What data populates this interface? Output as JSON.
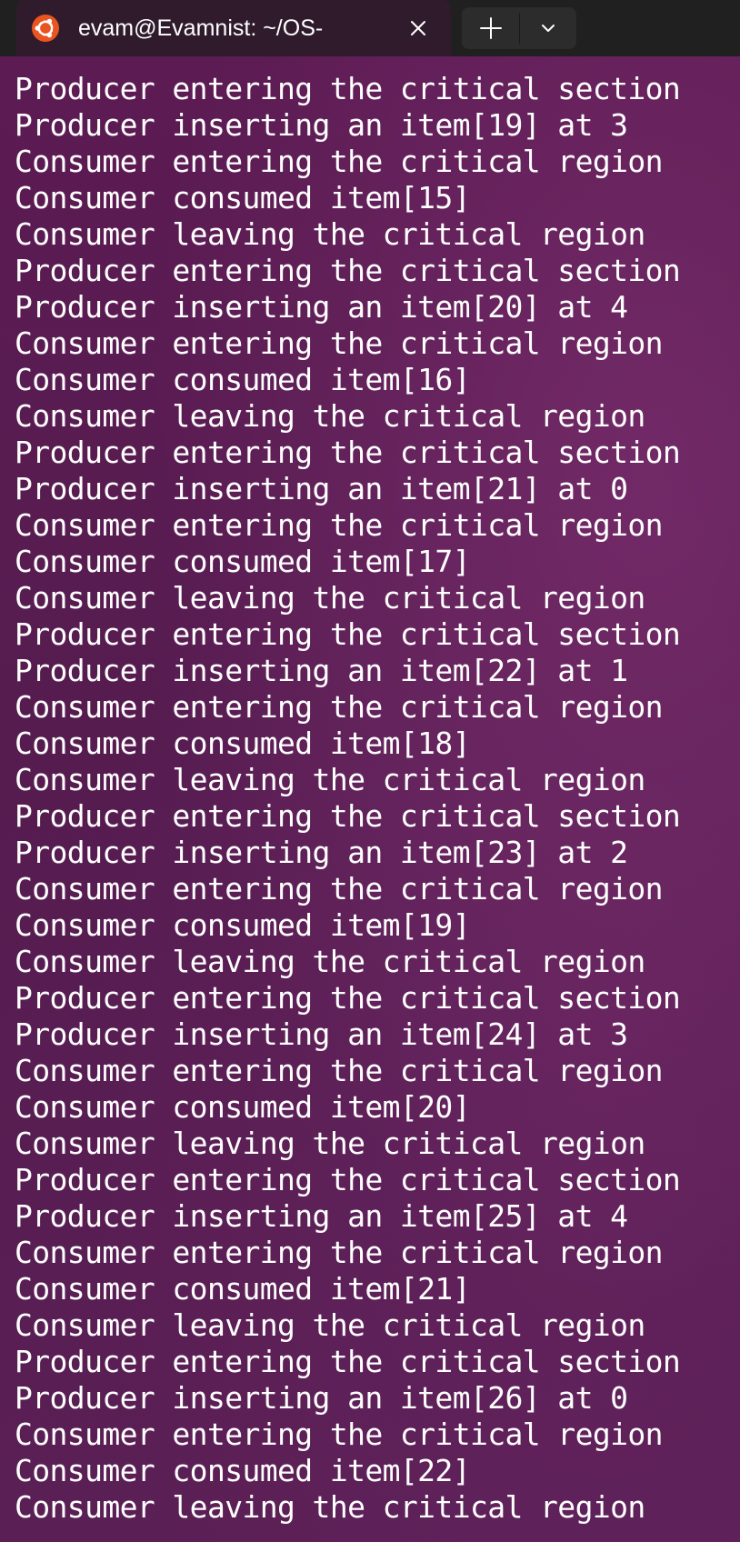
{
  "tab": {
    "title": "evam@Evamnist: ~/OS-",
    "icon": "ubuntu-logo-icon",
    "close_icon": "close-icon"
  },
  "toolbar": {
    "new_tab_icon": "plus-icon",
    "dropdown_icon": "chevron-down-icon"
  },
  "colors": {
    "terminal_bg": "#5c1b53",
    "titlebar_bg": "#202020",
    "tab_bg": "#2f1b2c",
    "ubuntu_orange": "#e95420",
    "text": "#ffffff"
  },
  "output": [
    "Producer entering the critical section",
    "Producer inserting an item[19] at 3",
    "Consumer entering the critical region",
    "Consumer consumed item[15]",
    "Consumer leaving the critical region",
    "Producer entering the critical section",
    "Producer inserting an item[20] at 4",
    "Consumer entering the critical region",
    "Consumer consumed item[16]",
    "Consumer leaving the critical region",
    "Producer entering the critical section",
    "Producer inserting an item[21] at 0",
    "Consumer entering the critical region",
    "Consumer consumed item[17]",
    "Consumer leaving the critical region",
    "Producer entering the critical section",
    "Producer inserting an item[22] at 1",
    "Consumer entering the critical region",
    "Consumer consumed item[18]",
    "Consumer leaving the critical region",
    "Producer entering the critical section",
    "Producer inserting an item[23] at 2",
    "Consumer entering the critical region",
    "Consumer consumed item[19]",
    "Consumer leaving the critical region",
    "Producer entering the critical section",
    "Producer inserting an item[24] at 3",
    "Consumer entering the critical region",
    "Consumer consumed item[20]",
    "Consumer leaving the critical region",
    "Producer entering the critical section",
    "Producer inserting an item[25] at 4",
    "Consumer entering the critical region",
    "Consumer consumed item[21]",
    "Consumer leaving the critical region",
    "Producer entering the critical section",
    "Producer inserting an item[26] at 0",
    "Consumer entering the critical region",
    "Consumer consumed item[22]",
    "Consumer leaving the critical region"
  ]
}
